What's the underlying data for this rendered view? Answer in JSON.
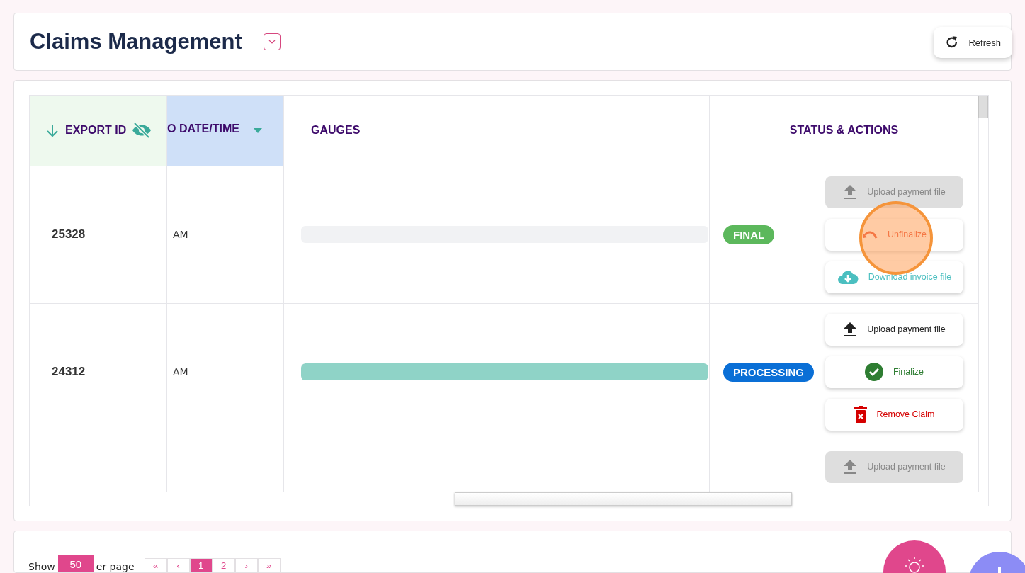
{
  "header": {
    "title": "Claims Management",
    "refresh_label": "Refresh"
  },
  "table": {
    "columns": [
      {
        "label": "EXPORT ID",
        "kind": "sorted"
      },
      {
        "label": "O DATE/TIME",
        "kind": "filter"
      },
      {
        "label": "GAUGES",
        "kind": "plain"
      },
      {
        "label": "STATUS & ACTIONS",
        "kind": "center"
      }
    ],
    "rows": [
      {
        "export_id": "25328",
        "time": "AM",
        "gauge": {
          "level": 0
        },
        "status": {
          "label": "FINAL",
          "color": "#5cb85c"
        },
        "actions": [
          {
            "kind": "upload",
            "label": "Upload payment file",
            "disabled": true
          },
          {
            "kind": "unfinalize",
            "label": "Unfinalize",
            "disabled": false
          },
          {
            "kind": "download",
            "label": "Download invoice file",
            "disabled": false
          }
        ]
      },
      {
        "export_id": "24312",
        "time": "AM",
        "gauge": {
          "level": 1
        },
        "status": {
          "label": "PROCESSING",
          "color": "#0a6fd6"
        },
        "actions": [
          {
            "kind": "upload",
            "label": "Upload payment file",
            "disabled": false
          },
          {
            "kind": "finalize",
            "label": "Finalize",
            "disabled": false
          },
          {
            "kind": "remove",
            "label": "Remove Claim",
            "disabled": false
          }
        ]
      },
      {
        "actions": [
          {
            "kind": "upload",
            "label": "Upload payment file",
            "disabled": true
          }
        ]
      }
    ]
  },
  "footer": {
    "show_label": "Show",
    "page_size": "50",
    "per_page_label": "er page",
    "pages": [
      {
        "label": "«",
        "selected": false
      },
      {
        "label": "‹",
        "selected": false
      },
      {
        "label": "1",
        "selected": true
      },
      {
        "label": "2",
        "selected": false
      },
      {
        "label": "›",
        "selected": false
      },
      {
        "label": "»",
        "selected": false
      }
    ]
  }
}
